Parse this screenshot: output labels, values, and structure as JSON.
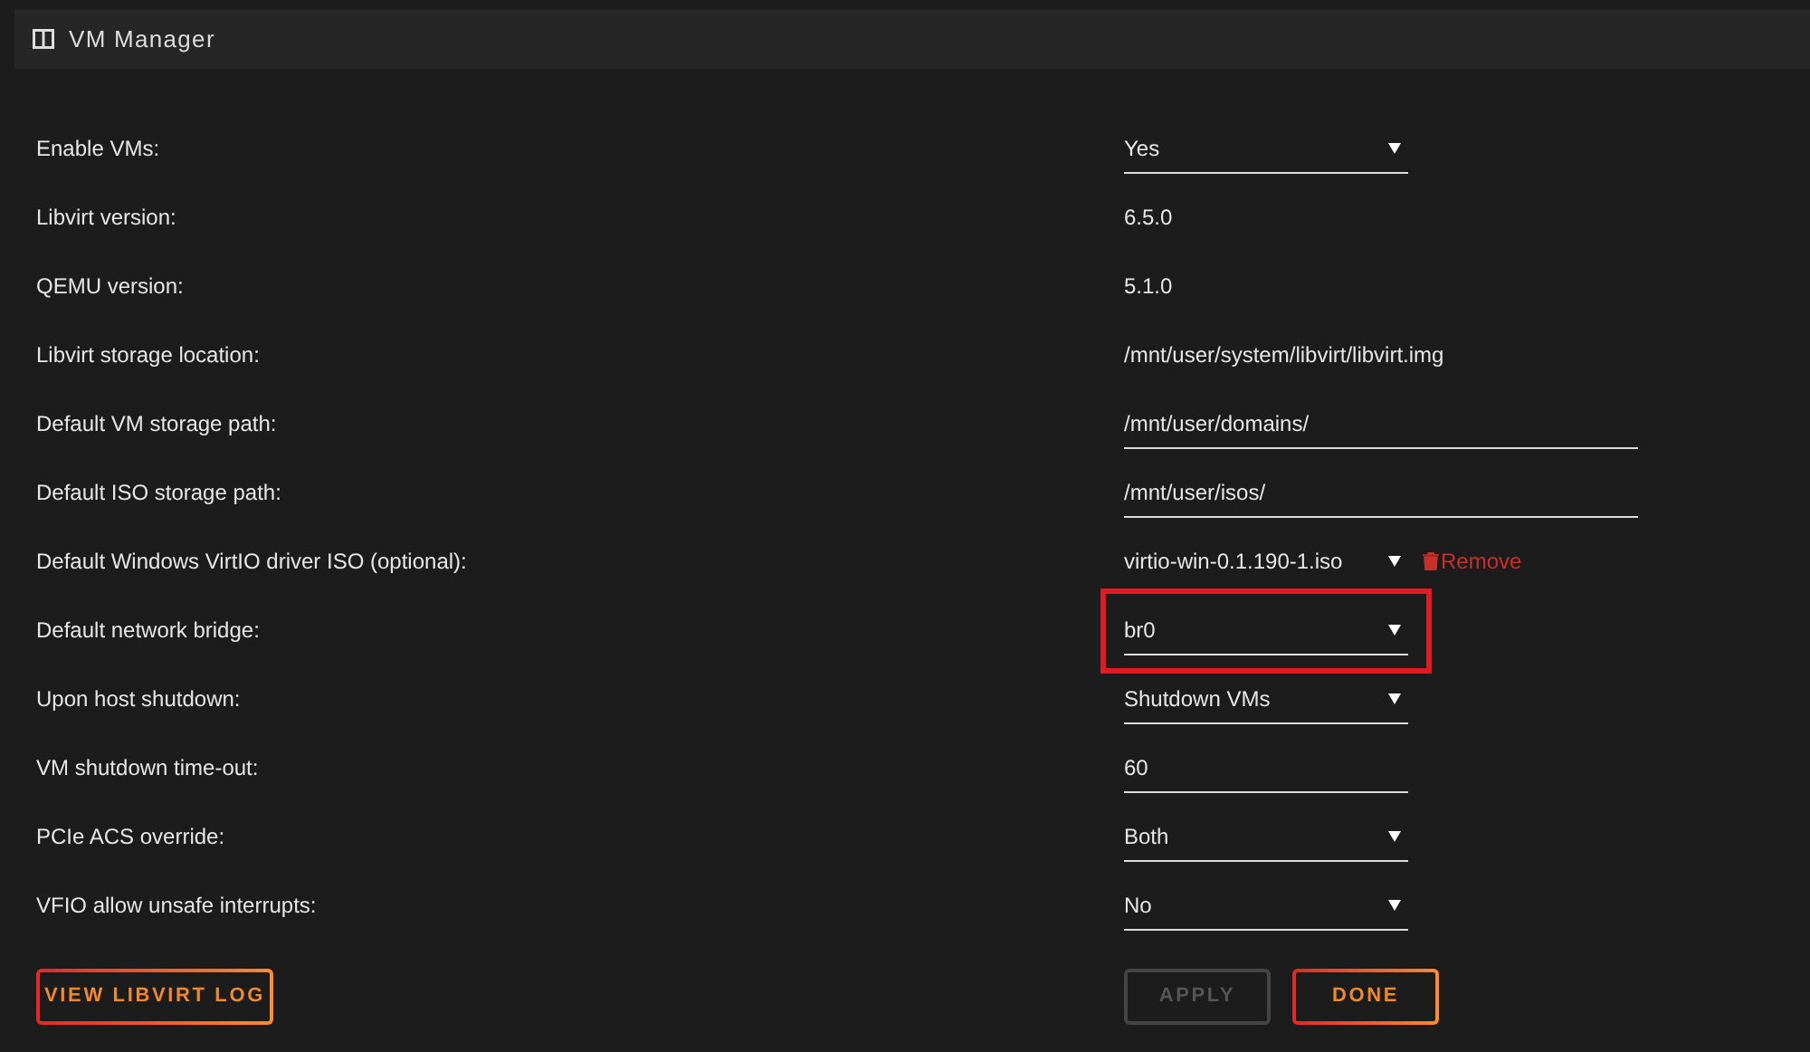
{
  "header": {
    "title": "VM Manager"
  },
  "settings": [
    {
      "label": "Enable VMs:",
      "kind": "select",
      "value": "Yes",
      "highlighted": false
    },
    {
      "label": "Libvirt version:",
      "kind": "text",
      "value": "6.5.0",
      "highlighted": false
    },
    {
      "label": "QEMU version:",
      "kind": "text",
      "value": "5.1.0",
      "highlighted": false
    },
    {
      "label": "Libvirt storage location:",
      "kind": "text",
      "value": "/mnt/user/system/libvirt/libvirt.img",
      "highlighted": false
    },
    {
      "label": "Default VM storage path:",
      "kind": "input",
      "value": "/mnt/user/domains/",
      "highlighted": false
    },
    {
      "label": "Default ISO storage path:",
      "kind": "input",
      "value": "/mnt/user/isos/",
      "highlighted": false
    },
    {
      "label": "Default Windows VirtIO driver ISO (optional):",
      "kind": "select_remove",
      "value": "virtio-win-0.1.190-1.iso",
      "action": "Remove",
      "highlighted": false
    },
    {
      "label": "Default network bridge:",
      "kind": "select",
      "value": "br0",
      "highlighted": true
    },
    {
      "label": "Upon host shutdown:",
      "kind": "select",
      "value": "Shutdown VMs",
      "highlighted": false
    },
    {
      "label": "VM shutdown time-out:",
      "kind": "input_short",
      "value": "60",
      "highlighted": false
    },
    {
      "label": "PCIe ACS override:",
      "kind": "select",
      "value": "Both",
      "highlighted": false
    },
    {
      "label": "VFIO allow unsafe interrupts:",
      "kind": "select",
      "value": "No",
      "highlighted": false
    }
  ],
  "buttons": {
    "log": {
      "label": "VIEW LIBVIRT LOG",
      "disabled": false
    },
    "apply": {
      "label": "APPLY",
      "disabled": true
    },
    "done": {
      "label": "DONE",
      "disabled": false
    }
  }
}
